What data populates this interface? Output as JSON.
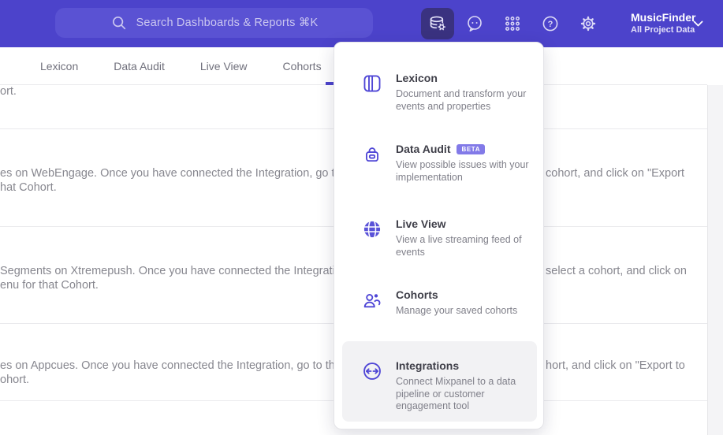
{
  "navbar": {
    "search": {
      "placeholder": "Search Dashboards & Reports ⌘K"
    },
    "project": {
      "name": "MusicFinder",
      "scope": "All Project Data"
    },
    "icons": [
      "search-icon",
      "database-gear-icon",
      "feedback-icon",
      "apps-grid-icon",
      "help-icon",
      "settings-gear-icon",
      "chevron-down-icon"
    ]
  },
  "tabs": {
    "items": [
      {
        "label": "Lexicon"
      },
      {
        "label": "Data Audit"
      },
      {
        "label": "Live View"
      },
      {
        "label": "Cohorts"
      }
    ]
  },
  "background": {
    "rows": [
      {
        "line1_left": "ort.",
        "line1_right": "",
        "line2_left": ""
      },
      {
        "line1_left": "es on WebEngage. Once you have connected the Integration, go to the",
        "line1_right": "cohort, and click on \"Export",
        "line2_left": "hat Cohort."
      },
      {
        "line1_left": "Segments on Xtremepush. Once you have connected the Integration,",
        "line1_right": "select a cohort, and click on",
        "line2_left": "enu for that Cohort."
      },
      {
        "line1_left": "es on Appcues. Once you have connected the Integration, go to the M",
        "line1_right": "hort, and click on \"Export to",
        "line2_left": "ohort."
      }
    ]
  },
  "dropdown": {
    "items": [
      {
        "title": "Lexicon",
        "description": "Document and transform your events and properties",
        "icon": "book-icon"
      },
      {
        "title": "Data Audit",
        "badge": "BETA",
        "description": "View possible issues with your implementation",
        "icon": "lock-audit-icon"
      },
      {
        "title": "Live View",
        "description": "View a live streaming feed of events",
        "icon": "globe-icon"
      },
      {
        "title": "Cohorts",
        "description": "Manage your saved cohorts",
        "icon": "people-icon"
      },
      {
        "title": "Integrations",
        "description": "Connect Mixpanel to a data pipeline or customer engagement tool",
        "icon": "sync-arrows-icon",
        "hovered": true
      }
    ]
  },
  "colors": {
    "navbar_bg": "#4c43cb",
    "search_bg": "#5a52d3",
    "active_icon_bg": "#3a3280",
    "accent": "#4c43cb",
    "menu_icon": "#4f46d6",
    "beta_badge_bg": "#827ae8",
    "hover_item_bg": "#f2f2f4",
    "muted_text": "#87878f"
  }
}
